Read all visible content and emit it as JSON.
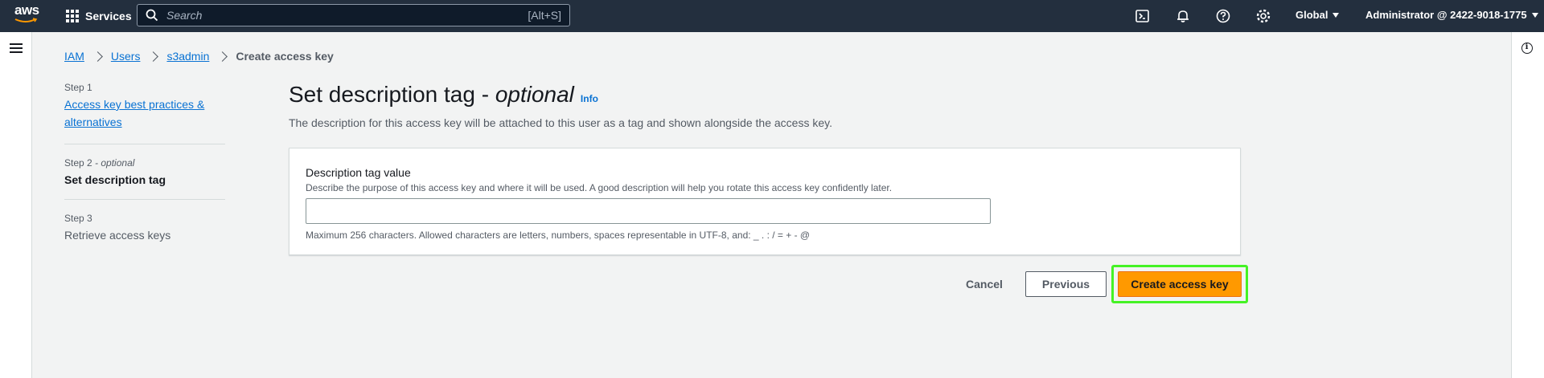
{
  "topnav": {
    "logo_text": "aws",
    "services_label": "Services",
    "search_placeholder": "Search",
    "search_shortcut": "[Alt+S]",
    "region_label": "Global",
    "account_label": "Administrator @ 2422-9018-1775"
  },
  "breadcrumb": {
    "items": [
      "IAM",
      "Users",
      "s3admin"
    ],
    "current": "Create access key"
  },
  "steps": [
    {
      "label": "Step 1",
      "title": "Access key best practices & alternatives"
    },
    {
      "label": "Step 2",
      "label_suffix": "- optional",
      "title": "Set description tag"
    },
    {
      "label": "Step 3",
      "title": "Retrieve access keys"
    }
  ],
  "main": {
    "title": "Set description tag -",
    "title_optional": "optional",
    "info_link": "Info",
    "description": "The description for this access key will be attached to this user as a tag and shown alongside the access key."
  },
  "form": {
    "field_label": "Description tag value",
    "field_description": "Describe the purpose of this access key and where it will be used. A good description will help you rotate this access key confidently later.",
    "field_value": "",
    "constraint": "Maximum 256 characters. Allowed characters are letters, numbers, spaces representable in UTF-8, and: _ . : / = + - @"
  },
  "actions": {
    "cancel": "Cancel",
    "previous": "Previous",
    "create": "Create access key"
  },
  "colors": {
    "nav_bg": "#232f3e",
    "link": "#0972d3",
    "primary": "#ff9900",
    "highlight": "#45f225"
  }
}
